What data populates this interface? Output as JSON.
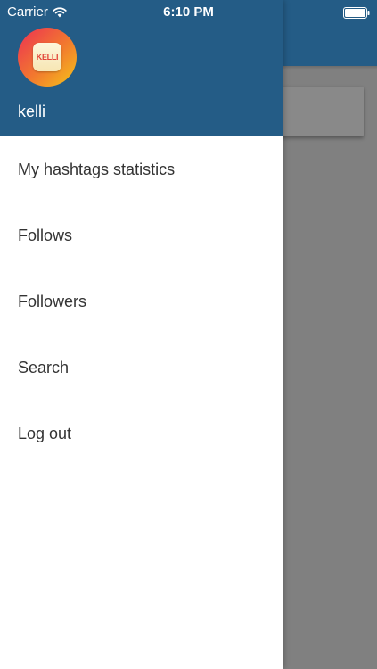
{
  "status_bar": {
    "carrier": "Carrier",
    "time": "6:10 PM",
    "wifi_icon": "wifi-icon",
    "battery_icon": "battery-icon"
  },
  "drawer": {
    "avatar_text": "KELLI",
    "username": "kelli",
    "items": [
      {
        "label": "My hashtags statistics"
      },
      {
        "label": "Follows"
      },
      {
        "label": "Followers"
      },
      {
        "label": "Search"
      },
      {
        "label": "Log out"
      }
    ]
  },
  "colors": {
    "header": "#245c86",
    "scrim": "#808080",
    "menu_text": "#333333"
  }
}
